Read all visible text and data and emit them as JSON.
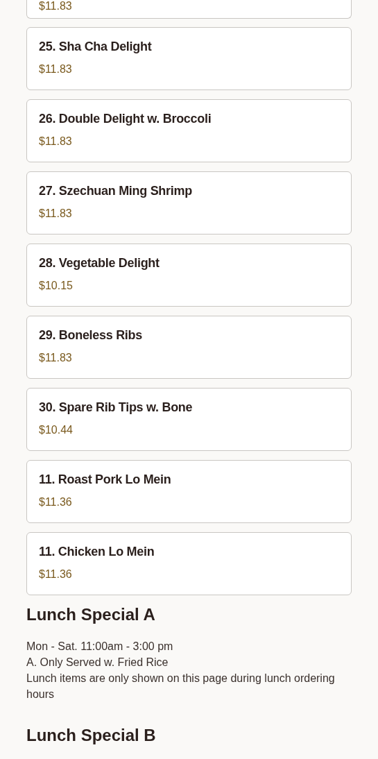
{
  "partial_item": {
    "price": "$11.83"
  },
  "items": [
    {
      "name": "25. Sha Cha Delight",
      "price": "$11.83"
    },
    {
      "name": "26. Double Delight w. Broccoli",
      "price": "$11.83"
    },
    {
      "name": "27. Szechuan Ming Shrimp",
      "price": "$11.83"
    },
    {
      "name": "28. Vegetable Delight",
      "price": "$10.15"
    },
    {
      "name": "29. Boneless Ribs",
      "price": "$11.83"
    },
    {
      "name": "30. Spare Rib Tips w. Bone",
      "price": "$10.44"
    },
    {
      "name": "11. Roast Pork Lo Mein",
      "price": "$11.36"
    },
    {
      "name": "11. Chicken Lo Mein",
      "price": "$11.36"
    }
  ],
  "sections": [
    {
      "title": "Lunch Special A",
      "lines": [
        "Mon - Sat. 11:00am - 3:00 pm",
        "A. Only Served w. Fried Rice",
        "Lunch items are only shown on this page during lunch ordering hours"
      ]
    },
    {
      "title": "Lunch Special B"
    }
  ]
}
